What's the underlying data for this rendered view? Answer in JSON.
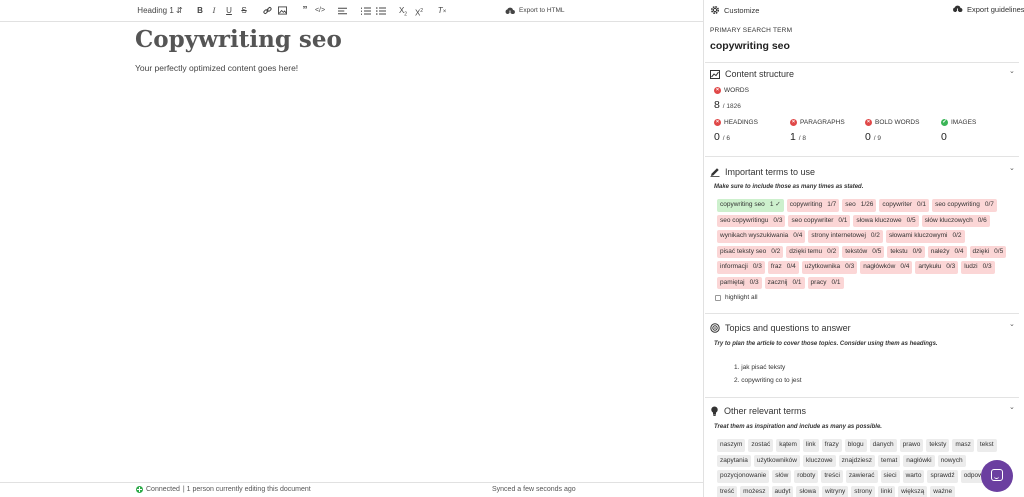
{
  "toolbar": {
    "heading_select": "Heading 1 ⇵",
    "export_html": "Export to HTML"
  },
  "document": {
    "title": "Copywriting seo",
    "body": "Your perfectly optimized content goes here!"
  },
  "status": {
    "connected": "Connected",
    "editors": "| 1 person currently editing this document",
    "synced": "Synced a few seconds ago"
  },
  "sidebar": {
    "customize": "Customize",
    "export_guidelines": "Export guidelines",
    "primary_label": "PRIMARY SEARCH TERM",
    "primary_value": "copywriting seo",
    "structure": {
      "title": "Content structure",
      "words_label": "WORDS",
      "words_value": "8",
      "words_target": "/ 1826",
      "headings_label": "HEADINGS",
      "headings_value": "0",
      "headings_target": "/ 6",
      "paragraphs_label": "PARAGRAPHS",
      "paragraphs_value": "1",
      "paragraphs_target": "/ 8",
      "bold_label": "BOLD WORDS",
      "bold_value": "0",
      "bold_target": "/ 9",
      "images_label": "IMAGES",
      "images_value": "0"
    },
    "important": {
      "title": "Important terms to use",
      "hint": "Make sure to include those as many times as stated.",
      "highlight_all": "highlight all",
      "terms": [
        {
          "term": "copywriting seo",
          "count": "1 ✓",
          "state": "green"
        },
        {
          "term": "copywriting",
          "count": "1/7",
          "state": "red"
        },
        {
          "term": "seo",
          "count": "1/26",
          "state": "red"
        },
        {
          "term": "copywriter",
          "count": "0/1",
          "state": "red"
        },
        {
          "term": "seo copywriting",
          "count": "0/7",
          "state": "red"
        },
        {
          "term": "seo copywritingu",
          "count": "0/3",
          "state": "red"
        },
        {
          "term": "seo copywriter",
          "count": "0/1",
          "state": "red"
        },
        {
          "term": "słowa kluczowe",
          "count": "0/5",
          "state": "red"
        },
        {
          "term": "słów kluczowych",
          "count": "0/6",
          "state": "red"
        },
        {
          "term": "wynikach wyszukiwania",
          "count": "0/4",
          "state": "red"
        },
        {
          "term": "strony internetowej",
          "count": "0/2",
          "state": "red"
        },
        {
          "term": "słowami kluczowymi",
          "count": "0/2",
          "state": "red"
        },
        {
          "term": "pisać teksty seo",
          "count": "0/2",
          "state": "red"
        },
        {
          "term": "dzięki temu",
          "count": "0/2",
          "state": "red"
        },
        {
          "term": "tekstów",
          "count": "0/5",
          "state": "red"
        },
        {
          "term": "tekstu",
          "count": "0/9",
          "state": "red"
        },
        {
          "term": "należy",
          "count": "0/4",
          "state": "red"
        },
        {
          "term": "dzięki",
          "count": "0/5",
          "state": "red"
        },
        {
          "term": "informacji",
          "count": "0/3",
          "state": "red"
        },
        {
          "term": "fraz",
          "count": "0/4",
          "state": "red"
        },
        {
          "term": "użytkownika",
          "count": "0/3",
          "state": "red"
        },
        {
          "term": "nagłówków",
          "count": "0/4",
          "state": "red"
        },
        {
          "term": "artykułu",
          "count": "0/3",
          "state": "red"
        },
        {
          "term": "ludzi",
          "count": "0/3",
          "state": "red"
        },
        {
          "term": "pamiętaj",
          "count": "0/3",
          "state": "red"
        },
        {
          "term": "zacznij",
          "count": "0/1",
          "state": "red"
        },
        {
          "term": "pracy",
          "count": "0/1",
          "state": "red"
        }
      ]
    },
    "topics": {
      "title": "Topics and questions to answer",
      "hint": "Try to plan the article to cover those topics. Consider using them as headings.",
      "items": [
        "1. jak pisać teksty",
        "2. copywriting co to jest"
      ]
    },
    "other": {
      "title": "Other relevant terms",
      "hint": "Treat them as inspiration and include as many as possible.",
      "terms": [
        "naszym",
        "zostać",
        "kątem",
        "link",
        "frazy",
        "blogu",
        "danych",
        "prawo",
        "teksty",
        "masz",
        "tekst",
        "zapytania",
        "użytkowników",
        "kluczowe",
        "znajdziesz",
        "temat",
        "nagłówki",
        "nowych",
        "pozycjonowanie",
        "słów",
        "roboty",
        "treści",
        "zawierać",
        "sieci",
        "warto",
        "sprawdź",
        "odpowiednio",
        "treść",
        "możesz",
        "audyt",
        "słowa",
        "witryny",
        "strony",
        "linki",
        "większą",
        "ważne"
      ]
    }
  },
  "colors": {
    "term_missing": "#fbd6d6",
    "term_ok": "#cdf0cd",
    "chat": "#6b3fa0"
  }
}
